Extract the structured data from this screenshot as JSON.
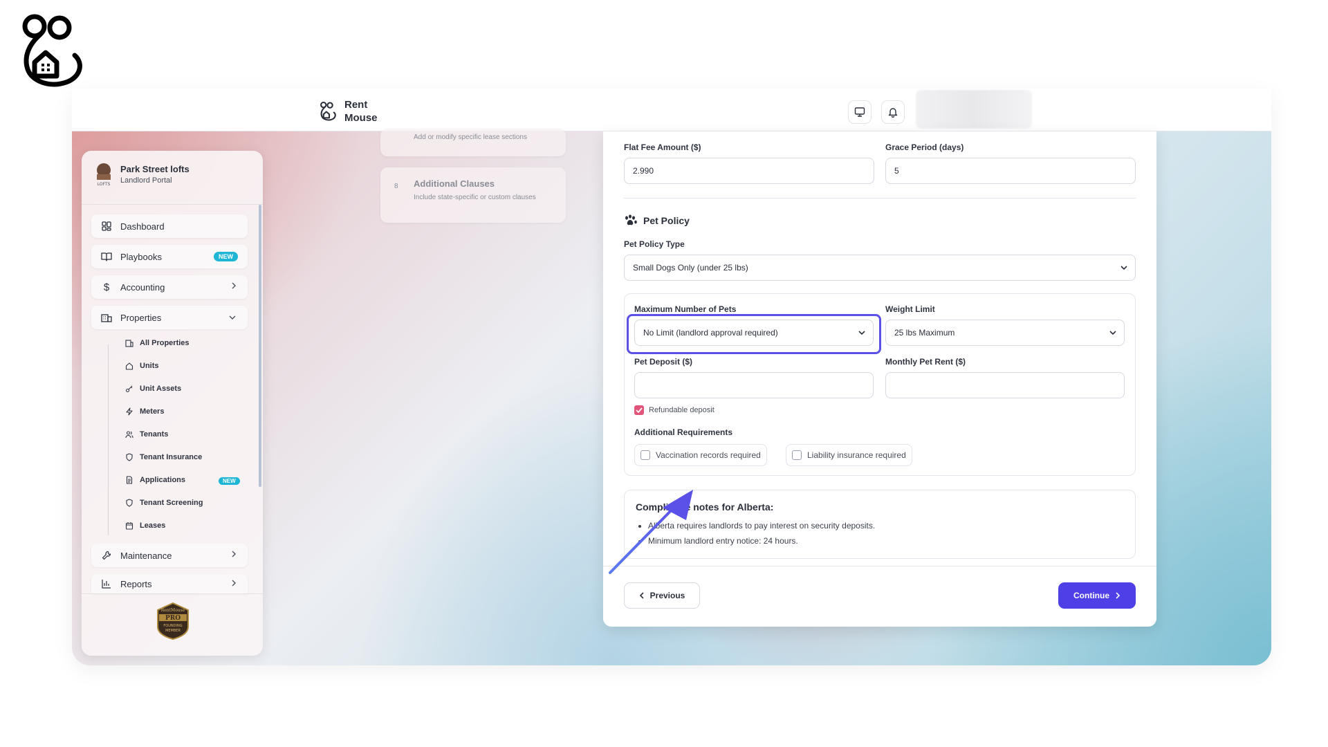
{
  "header": {
    "app_name": "Rent Mouse",
    "icons": [
      "rent-mouse-logo-icon",
      "monitor-icon",
      "bell-icon"
    ]
  },
  "sidebar": {
    "property_name": "Park Street lofts",
    "portal_label": "Landlord Portal",
    "nav": [
      {
        "label": "Dashboard",
        "icon": "dashboard-grid-icon"
      },
      {
        "label": "Playbooks",
        "icon": "book-icon",
        "badge": "NEW"
      },
      {
        "label": "Accounting",
        "icon": "dollar-icon"
      },
      {
        "label": "Properties",
        "icon": "building-icon",
        "expanded": true
      },
      {
        "label": "Maintenance",
        "icon": "wrench-icon"
      },
      {
        "label": "Reports",
        "icon": "bar-chart-icon"
      }
    ],
    "sub_items": [
      {
        "label": "All Properties",
        "icon": "building-icon"
      },
      {
        "label": "Units",
        "icon": "home-icon"
      },
      {
        "label": "Unit Assets",
        "icon": "key-icon"
      },
      {
        "label": "Meters",
        "icon": "lightning-icon"
      },
      {
        "label": "Tenants",
        "icon": "users-icon"
      },
      {
        "label": "Tenant Insurance",
        "icon": "shield-icon"
      },
      {
        "label": "Applications",
        "icon": "document-icon",
        "badge": "NEW"
      },
      {
        "label": "Tenant Screening",
        "icon": "shield-icon"
      },
      {
        "label": "Leases",
        "icon": "calendar-icon"
      }
    ],
    "footer_badge_text": [
      "RentMouse",
      "PRO",
      "FOUNDING",
      "MEMBER"
    ]
  },
  "steps": [
    {
      "number": "",
      "title": "",
      "description": "Add or modify specific lease sections"
    },
    {
      "number": "8",
      "title": "Additional Clauses",
      "description": "Include state-specific or custom clauses"
    }
  ],
  "form": {
    "flat_fee_label": "Flat Fee Amount ($)",
    "flat_fee_value": "2.990",
    "grace_label": "Grace Period (days)",
    "grace_value": "5",
    "pet_section_title": "Pet Policy",
    "pet_type_label": "Pet Policy Type",
    "pet_type_value": "Small Dogs Only (under 25 lbs)",
    "max_pets_label": "Maximum Number of Pets",
    "max_pets_value": "No Limit (landlord approval required)",
    "weight_label": "Weight Limit",
    "weight_value": "25 lbs Maximum",
    "deposit_label": "Pet Deposit ($)",
    "deposit_value": "",
    "rent_label": "Monthly Pet Rent ($)",
    "rent_value": "",
    "refundable_label": "Refundable deposit",
    "refundable_checked": true,
    "additional_label": "Additional Requirements",
    "vaccination_label": "Vaccination records required",
    "liability_label": "Liability insurance required"
  },
  "compliance": {
    "title": "Compliance notes for Alberta:",
    "notes": [
      "Alberta requires landlords to pay interest on security deposits.",
      "Minimum landlord entry notice: 24 hours."
    ]
  },
  "footer": {
    "previous_label": "Previous",
    "continue_label": "Continue"
  },
  "colors": {
    "accent": "#4f3fe6",
    "highlight": "#5b50e8",
    "badge": "#1fb6d6",
    "checkbox": "#e2557a"
  }
}
